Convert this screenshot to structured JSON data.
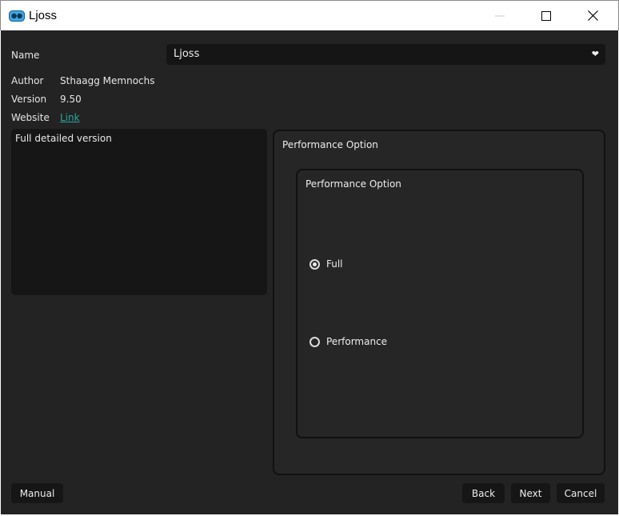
{
  "window": {
    "title": "Ljoss",
    "minimize_glyph": "—",
    "icon": "app-logo-icon"
  },
  "info": {
    "name_label": "Name",
    "name_value": "Ljoss",
    "author_label": "Author",
    "author_value": "Sthaagg Memnochs",
    "version_label": "Version",
    "version_value": "9.50",
    "website_label": "Website",
    "website_link_text": "Link"
  },
  "description": "Full detailed version",
  "performance": {
    "outer_title": "Performance Option",
    "inner_title": "Performance Option",
    "options": [
      {
        "label": "Full",
        "checked": true
      },
      {
        "label": "Performance",
        "checked": false
      }
    ]
  },
  "buttons": {
    "manual": "Manual",
    "back": "Back",
    "next": "Next",
    "cancel": "Cancel"
  },
  "colors": {
    "background": "#232323",
    "field": "#151515",
    "link": "#2aa7a1",
    "icon_blue": "#3aa8e6"
  }
}
